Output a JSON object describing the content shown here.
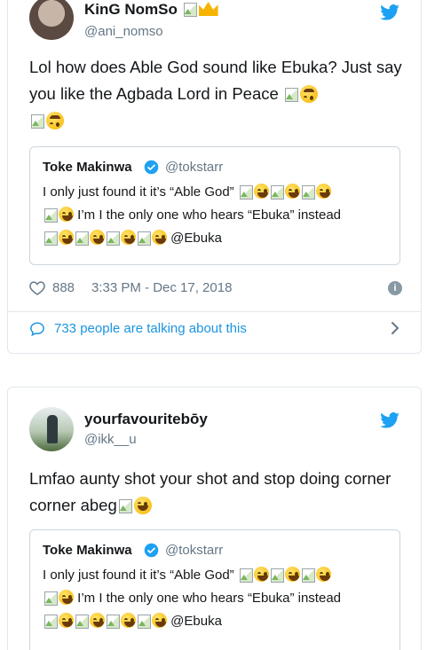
{
  "tweet1": {
    "display_name": "KinG NomSo",
    "handle": "@ani_nomso",
    "text": "Lol how does Able God sound like Ebuka? Just say you like the Agbada Lord in Peace",
    "quoted": {
      "display_name": "Toke Makinwa",
      "handle": "@tokstarr",
      "line1": "I only just found it it’s “Able God”",
      "line2": "I’m I the only one who hears  “Ebuka” instead",
      "mention": "@Ebuka"
    },
    "likes": "888",
    "timestamp": "3:33 PM - Dec 17, 2018",
    "talking": "733 people are talking about this"
  },
  "tweet2": {
    "display_name": "yourfavouritebōy",
    "handle": "@ikk__u",
    "text": "Lmfao aunty shot your shot and stop doing corner corner abeg",
    "quoted": {
      "display_name": "Toke Makinwa",
      "handle": "@tokstarr",
      "line1": "I only just found it it’s “Able God”",
      "line2": "I’m I the only one who hears  “Ebuka” instead",
      "mention": "@Ebuka"
    }
  },
  "colors": {
    "twitter_blue": "#1da1f2",
    "link_blue": "#1b95e0",
    "muted": "#657786",
    "border": "#e1e8ed"
  },
  "icons": [
    "twitter-bird-icon",
    "verified-badge-icon",
    "heart-icon",
    "info-icon",
    "speech-bubble-icon",
    "chevron-right-icon",
    "broken-image-icon",
    "laughing-emoji-icon",
    "upside-down-face-icon",
    "crown-icon"
  ]
}
